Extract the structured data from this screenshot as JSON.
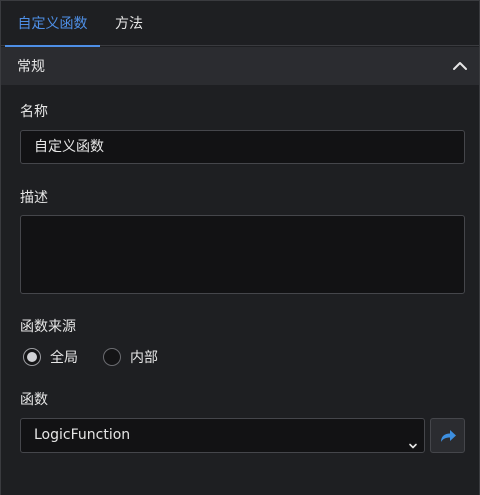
{
  "tabs": [
    {
      "label": "自定义函数",
      "active": true
    },
    {
      "label": "方法",
      "active": false
    }
  ],
  "section": {
    "title": "常规",
    "icon": "chevron-up-icon"
  },
  "fields": {
    "name_label": "名称",
    "name_value": "自定义函数",
    "desc_label": "描述",
    "desc_value": "",
    "source_label": "函数来源",
    "source_options": [
      {
        "label": "全局",
        "checked": true
      },
      {
        "label": "内部",
        "checked": false
      }
    ],
    "function_label": "函数",
    "function_value": "LogicFunction",
    "function_icon": "chevron-down-icon",
    "goto_icon": "share-arrow-icon"
  },
  "colors": {
    "accent": "#4e8fe6",
    "background": "#1e1f22",
    "panel": "#2b2c30",
    "input_bg": "#121214",
    "goto_arrow": "#3d8fe0"
  }
}
